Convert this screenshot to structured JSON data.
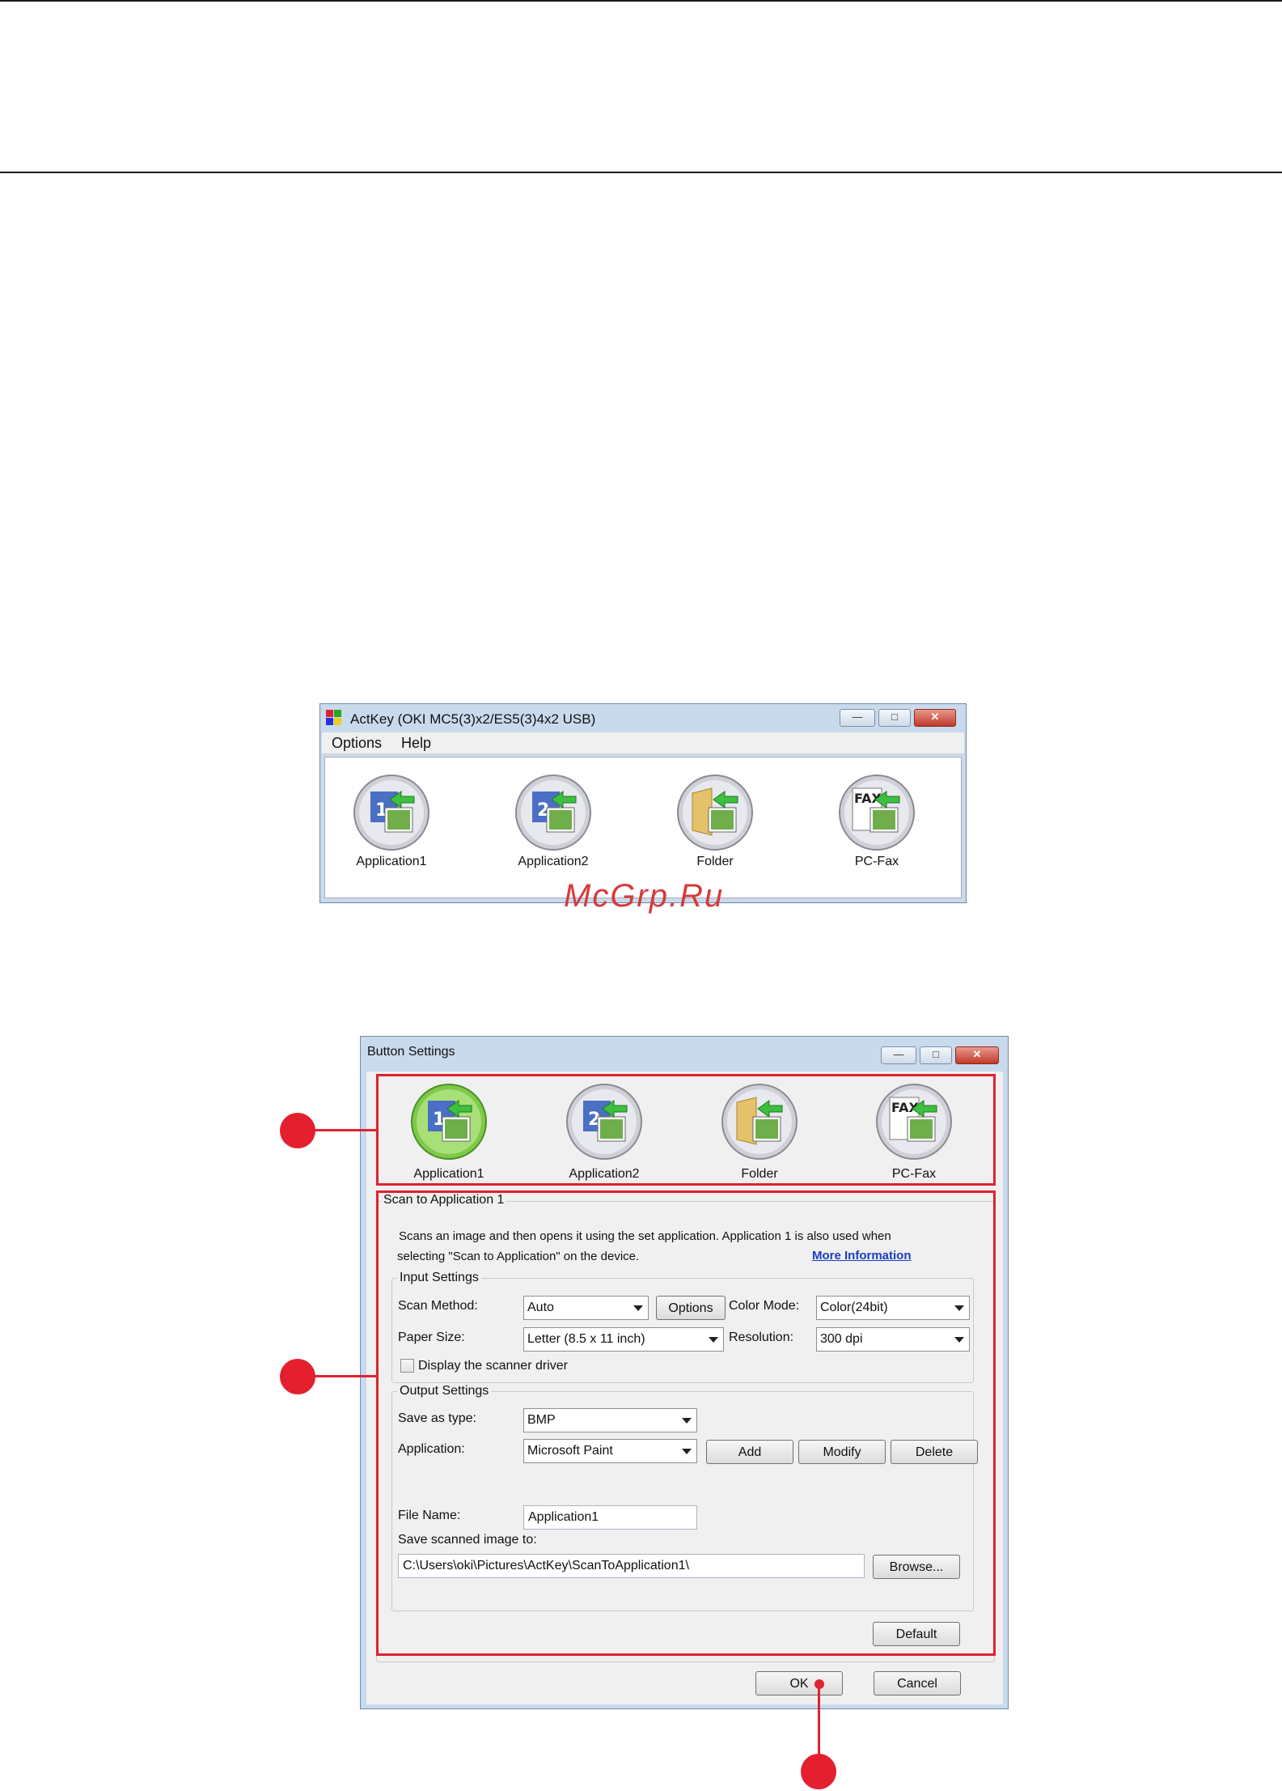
{
  "watermark": "McGrp.Ru",
  "actkey": {
    "title": "ActKey (OKI MC5(3)x2/ES5(3)4x2 USB)",
    "menu": [
      "Options",
      "Help"
    ],
    "buttons": [
      {
        "label": "Application1",
        "icon": "application1-scan-icon"
      },
      {
        "label": "Application2",
        "icon": "application2-scan-icon"
      },
      {
        "label": "Folder",
        "icon": "folder-scan-icon"
      },
      {
        "label": "PC-Fax",
        "icon": "pc-fax-scan-icon"
      }
    ],
    "window_controls": {
      "minimize": "—",
      "maximize": "□",
      "close": "✕"
    }
  },
  "settings": {
    "title": "Button Settings",
    "buttons": [
      {
        "label": "Application1",
        "selected": true
      },
      {
        "label": "Application2",
        "selected": false
      },
      {
        "label": "Folder",
        "selected": false
      },
      {
        "label": "PC-Fax",
        "selected": false
      }
    ],
    "panel_title": "Scan to Application 1",
    "description_line1": "Scans an image and then opens it using the set application. Application 1 is also used when",
    "description_line2": "selecting \"Scan to Application\" on the device.",
    "more_info": "More Information",
    "input": {
      "title": "Input Settings",
      "scan_method_label": "Scan Method:",
      "scan_method_value": "Auto",
      "options_button": "Options",
      "color_mode_label": "Color Mode:",
      "color_mode_value": "Color(24bit)",
      "paper_size_label": "Paper Size:",
      "paper_size_value": "Letter (8.5 x 11 inch)",
      "resolution_label": "Resolution:",
      "resolution_value": "300 dpi",
      "display_driver_label": "Display the scanner driver",
      "display_driver_checked": false
    },
    "output": {
      "title": "Output Settings",
      "save_as_label": "Save as type:",
      "save_as_value": "BMP",
      "application_label": "Application:",
      "application_value": "Microsoft Paint",
      "add_button": "Add",
      "modify_button": "Modify",
      "delete_button": "Delete",
      "file_name_label": "File Name:",
      "file_name_value": "Application1",
      "save_to_label": "Save scanned image to:",
      "save_to_value": "C:\\Users\\oki\\Pictures\\ActKey\\ScanToApplication1\\",
      "browse_button": "Browse..."
    },
    "default_button": "Default",
    "ok_button": "OK",
    "cancel_button": "Cancel"
  },
  "colors": {
    "callout_red": "#e0222f",
    "selected_green": "#7ec94a",
    "link_blue": "#1a3dc2"
  }
}
